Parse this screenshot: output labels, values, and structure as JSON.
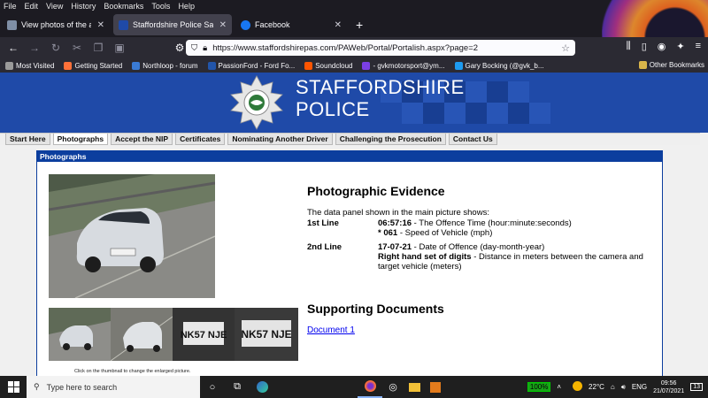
{
  "browser": {
    "menu": [
      "File",
      "Edit",
      "View",
      "History",
      "Bookmarks",
      "Tools",
      "Help"
    ],
    "tabs": [
      {
        "label": "View photos of the alleged offe",
        "active": false,
        "color": "#7f8fa6"
      },
      {
        "label": "Staffordshire Police Safer roads Tea",
        "active": true,
        "color": "#1f4aa8"
      },
      {
        "label": "Facebook",
        "active": false,
        "color": "#1877f2"
      }
    ],
    "new_tab": "+",
    "url": "https://www.staffordshirepas.com/PAWeb/Portal/Portalish.aspx?page=2",
    "bookmarks": [
      {
        "label": "Most Visited",
        "color": "#9a9a9a"
      },
      {
        "label": "Getting Started",
        "color": "#ff7139"
      },
      {
        "label": "Northloop - forum",
        "color": "#3a7bd5"
      },
      {
        "label": "PassionFord - Ford Fo...",
        "color": "#2255aa"
      },
      {
        "label": "Soundcloud",
        "color": "#ff5500"
      },
      {
        "label": "- gvkmotorsport@ym...",
        "color": "#7b3fe4"
      },
      {
        "label": "Gary Bocking (@gvk_b...",
        "color": "#1d9bf0"
      }
    ],
    "other_bookmarks": "Other Bookmarks"
  },
  "site": {
    "brand_line1": "STAFFORDSHIRE",
    "brand_line2": "POLICE",
    "nav": [
      {
        "label": "Start Here",
        "active": false
      },
      {
        "label": "Photographs",
        "active": true
      },
      {
        "label": "Accept the NIP",
        "active": false
      },
      {
        "label": "Certificates",
        "active": false
      },
      {
        "label": "Nominating Another Driver",
        "active": false
      },
      {
        "label": "Challenging the Prosecution",
        "active": false
      },
      {
        "label": "Contact Us",
        "active": false
      }
    ],
    "panel_title": "Photographs",
    "thumb_caption": "Click on the thumbnail to change the enlarged picture.",
    "plates": [
      "NK57 NJE",
      "NK57 NJE"
    ],
    "evidence": {
      "heading": "Photographic Evidence",
      "intro": "The data panel shown in the main picture shows:",
      "line1_label": "1st Line",
      "line1_time": "06:57:16",
      "line1_time_desc": " - The Offence Time (hour:minute:seconds)",
      "line1_speed": "* 061",
      "line1_speed_desc": " - Speed of Vehicle (mph)",
      "line2_label": "2nd Line",
      "line2_date": "17-07-21",
      "line2_date_desc": " - Date of Offence (day-month-year)",
      "line2_digits": "Right hand set of digits",
      "line2_digits_desc": " - Distance in meters between the camera and target vehicle (meters)"
    },
    "docs": {
      "heading": "Supporting Documents",
      "link": "Document 1"
    }
  },
  "taskbar": {
    "search_placeholder": "Type here to search",
    "battery": "100%",
    "weather": "22°C",
    "language": "ENG",
    "time": "09:56",
    "date": "21/07/2021",
    "notifications": "13"
  },
  "colors": {
    "police_blue": "#1f4aa8",
    "panel_blue": "#0c3e9e",
    "link": "#0000ee"
  }
}
